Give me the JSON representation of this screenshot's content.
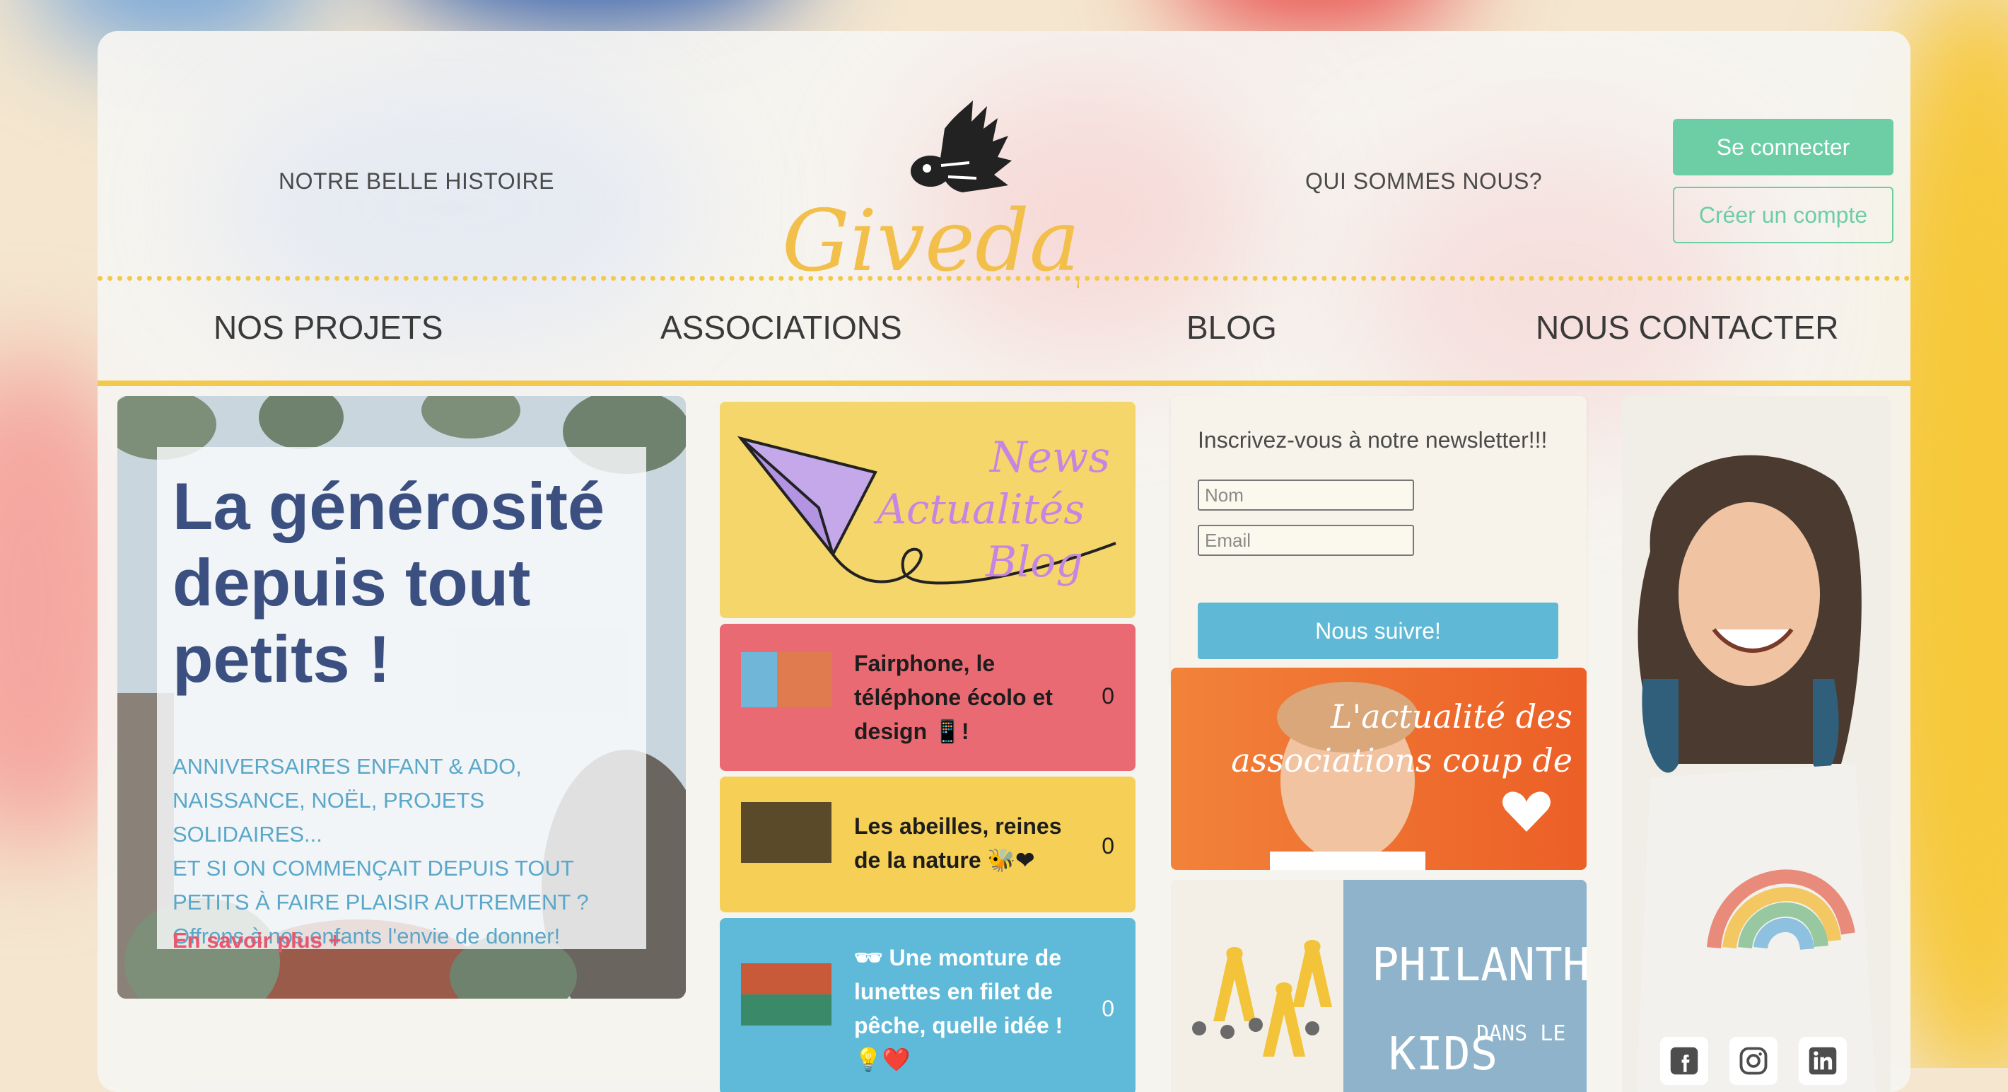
{
  "header": {
    "link_left": "NOTRE BELLE HISTOIRE",
    "link_right": "QUI SOMMES NOUS?",
    "logo_text": "Giveday",
    "login_label": "Se connecter",
    "register_label": "Créer un compte"
  },
  "nav": {
    "items": [
      {
        "label": "NOS PROJETS"
      },
      {
        "label": "ASSOCIATIONS"
      },
      {
        "label": "BLOG"
      },
      {
        "label": "NOUS CONTACTER"
      }
    ]
  },
  "hero": {
    "title": "La générosité depuis tout petits !",
    "lines": [
      "ANNIVERSAIRES ENFANT & ADO,",
      "NAISSANCE, NOËL, PROJETS SOLIDAIRES...",
      "ET SI ON COMMENÇAIT DEPUIS TOUT",
      "PETITS À FAIRE PLAISIR AUTREMENT ?",
      "Offrons à nos enfants l'envie de donner!"
    ],
    "more_label": "En savoir plus +"
  },
  "news_banner": {
    "words": [
      "News",
      "Actualités",
      "Blog"
    ]
  },
  "posts": [
    {
      "title": "Fairphone, le téléphone écolo et design 📱!",
      "count": "0",
      "color": "#ea6a73"
    },
    {
      "title": "Les abeilles, reines de la nature 🐝❤",
      "count": "0",
      "color": "#f5cf56"
    },
    {
      "title": "🕶 Une monture de lunettes en filet de pêche, quelle idée ! 💡❤️",
      "count": "0",
      "color": "#5fb9d8"
    }
  ],
  "newsletter": {
    "title": "Inscrivez-vous à notre newsletter!!!",
    "name_placeholder": "Nom",
    "email_placeholder": "Email",
    "button_label": "Nous suivre!"
  },
  "assoc_banner": {
    "text": "L'actualité des associations coup de"
  },
  "philanthro": {
    "word1": "PHILANTHRO",
    "word2": "KIDS",
    "word3": "DANS LE"
  },
  "colors": {
    "accent_yellow": "#f2c94c",
    "accent_green": "#6dcea6",
    "accent_blue": "#5fb9d6",
    "hero_title": "#3b5081"
  },
  "icons": [
    "facebook-icon",
    "instagram-icon",
    "linkedin-icon"
  ]
}
